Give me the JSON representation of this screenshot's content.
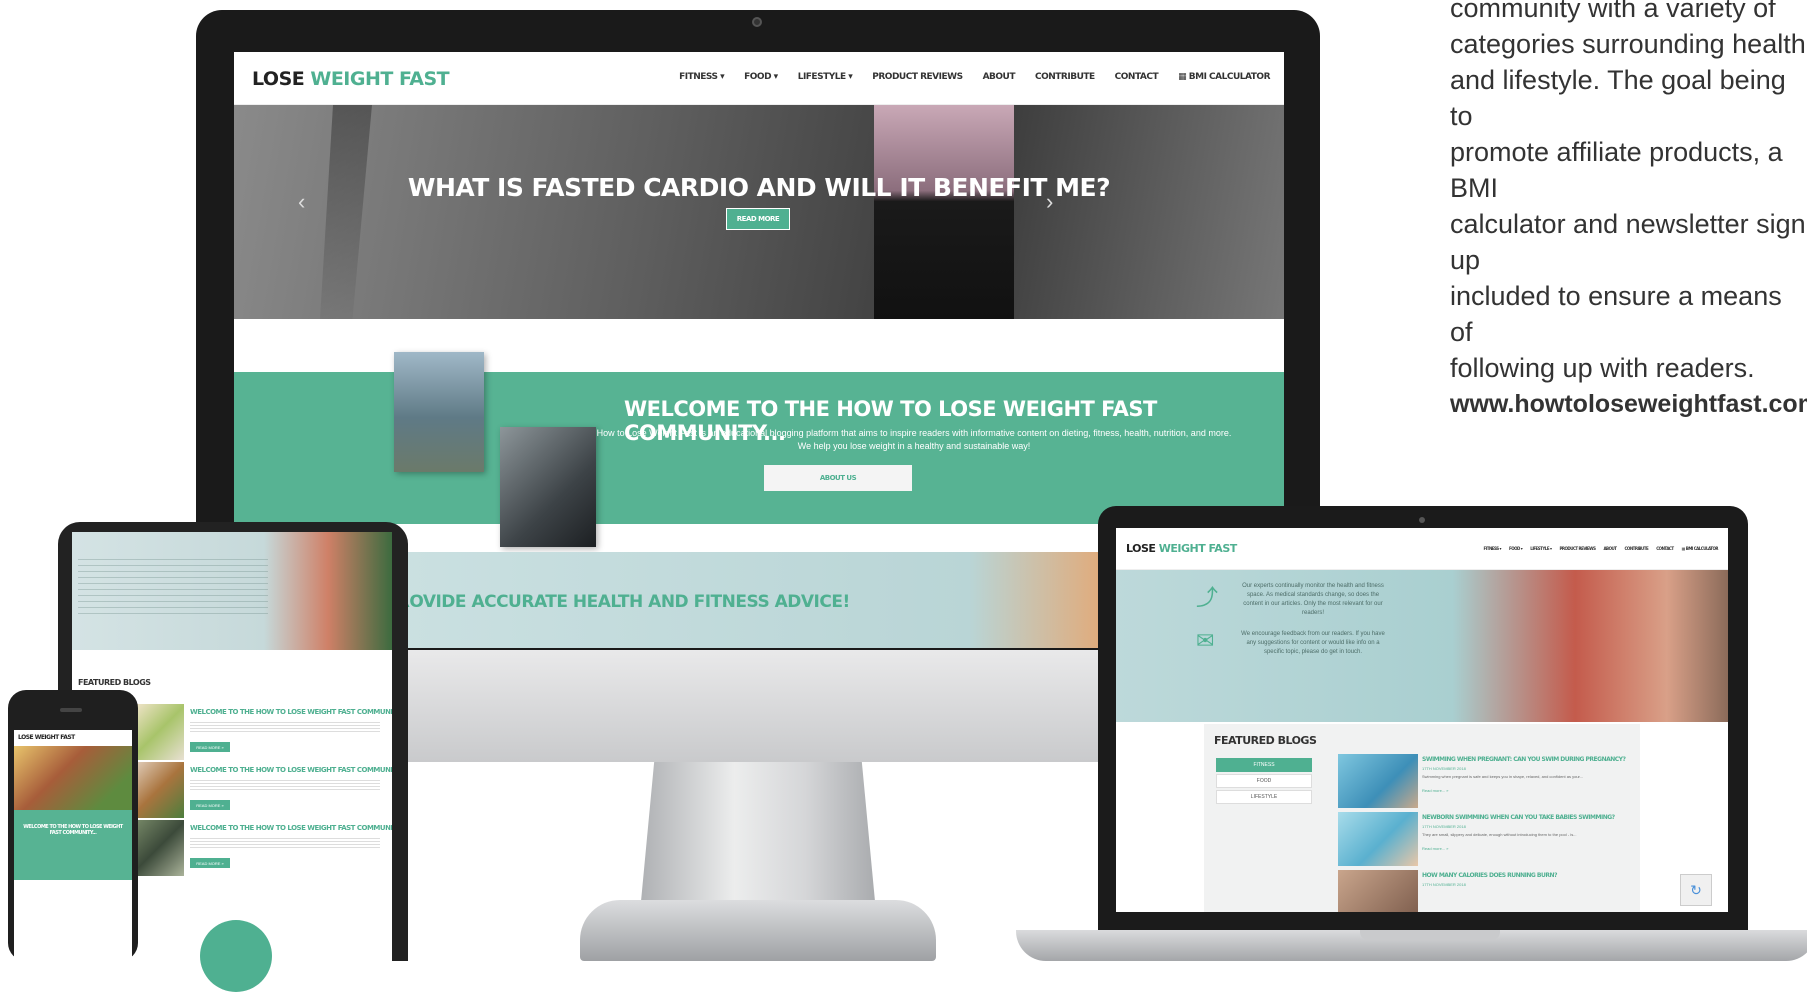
{
  "description": {
    "lines": [
      " community with a variety of",
      "categories surrounding health",
      "and lifestyle. The goal being to",
      "promote affiliate products, a BMI",
      "calculator and newsletter sign up",
      "included to ensure a means of",
      "following up with readers."
    ],
    "url": "www.howtoloseweightfast.com"
  },
  "site": {
    "logo_lose": "LOSE",
    "logo_rest": "WEIGHT FA",
    "logo_s": "S",
    "logo_t": "T",
    "nav": [
      "FITNESS ▾",
      "FOOD ▾",
      "LIFESTYLE ▾",
      "PRODUCT REVIEWS",
      "ABOUT",
      "CONTRIBUTE",
      "CONTACT",
      "▦ BMI CALCULATOR"
    ],
    "hero_title": "WHAT IS FASTED CARDIO AND WILL IT BENEFIT ME?",
    "hero_button": "READ MORE",
    "prev_arrow": "‹",
    "next_arrow": "›",
    "welcome_title": "WELCOME TO THE HOW TO LOSE WEIGHT FAST COMMUNITY...",
    "welcome_body": "How to Lose Weight Fast is an educational blogging platform that aims to inspire readers with informative content on dieting, fitness, health, nutrition, and more. We help you lose weight in a healthy and sustainable way!",
    "about_button": "ABOUT US",
    "advice_title": "WE PROVIDE ACCURATE HEALTH AND FITNESS ADVICE!"
  },
  "tablet": {
    "featured": "FEATURED BLOGS",
    "posts": [
      {
        "title": "WELCOME TO THE HOW TO LOSE WEIGHT FAST COMMUNITY...",
        "button": "READ MORE »"
      },
      {
        "title": "WELCOME TO THE HOW TO LOSE WEIGHT FAST COMMUNITY...",
        "button": "READ MORE »"
      },
      {
        "title": "WELCOME TO THE HOW TO LOSE WEIGHT FAST COMMUNITY...",
        "button": "READ MORE »"
      }
    ]
  },
  "phone": {
    "logo": "LOSE WEIGHT FAST",
    "welcome": "WELCOME TO THE HOW TO LOSE WEIGHT FAST COMMUNITY..."
  },
  "laptop": {
    "hero_line1": "Our experts continually monitor the health and fitness space. As medical standards change, so does the content in our articles. Only the most relevant for our readers!",
    "hero_line2": "We encourage feedback from our readers. If you have any suggestions for content or would like info on a specific topic, please do get in touch.",
    "featured": "FEATURED BLOGS",
    "tabs": [
      "FITNESS",
      "FOOD",
      "LIFESTYLE"
    ],
    "posts": [
      {
        "title": "SWIMMING WHEN PREGNANT: CAN YOU SWIM DURING PREGNANCY?",
        "date": "17TH NOVEMBER 2018",
        "body": "Swimming when pregnant is safe and keeps you in shape, relaxed, and confident as your...",
        "more": "Read more... »"
      },
      {
        "title": "NEWBORN SWIMMING WHEN CAN YOU TAKE BABIES SWIMMING?",
        "date": "17TH NOVEMBER 2018",
        "body": "They are small, slippery and delicate, enough without introducing them to the pool - is...",
        "more": "Read more... »"
      },
      {
        "title": "HOW MANY CALORIES DOES RUNNING BURN?",
        "date": "17TH NOVEMBER 2018",
        "body": "",
        "more": ""
      }
    ]
  },
  "colors": {
    "accent": "#4fb091",
    "text": "#333333"
  }
}
